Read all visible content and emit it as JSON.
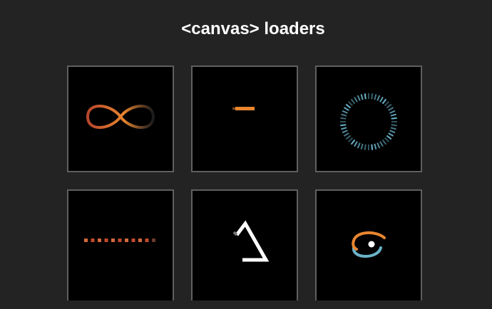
{
  "page": {
    "title": "<canvas> loaders"
  },
  "colors": {
    "background": "#232323",
    "tile_background": "#000000",
    "tile_border": "#5f5f5f",
    "orange": "#e8862f",
    "red_orange": "#c24a2a",
    "teal": "#6ab3c9",
    "white": "#ffffff"
  },
  "loaders": [
    {
      "icon": "infinity-loader-icon"
    },
    {
      "icon": "dash-loader-icon"
    },
    {
      "icon": "ring-loader-icon"
    },
    {
      "icon": "dots-row-loader-icon"
    },
    {
      "icon": "triangle-loader-icon"
    },
    {
      "icon": "orbit-loader-icon"
    }
  ]
}
